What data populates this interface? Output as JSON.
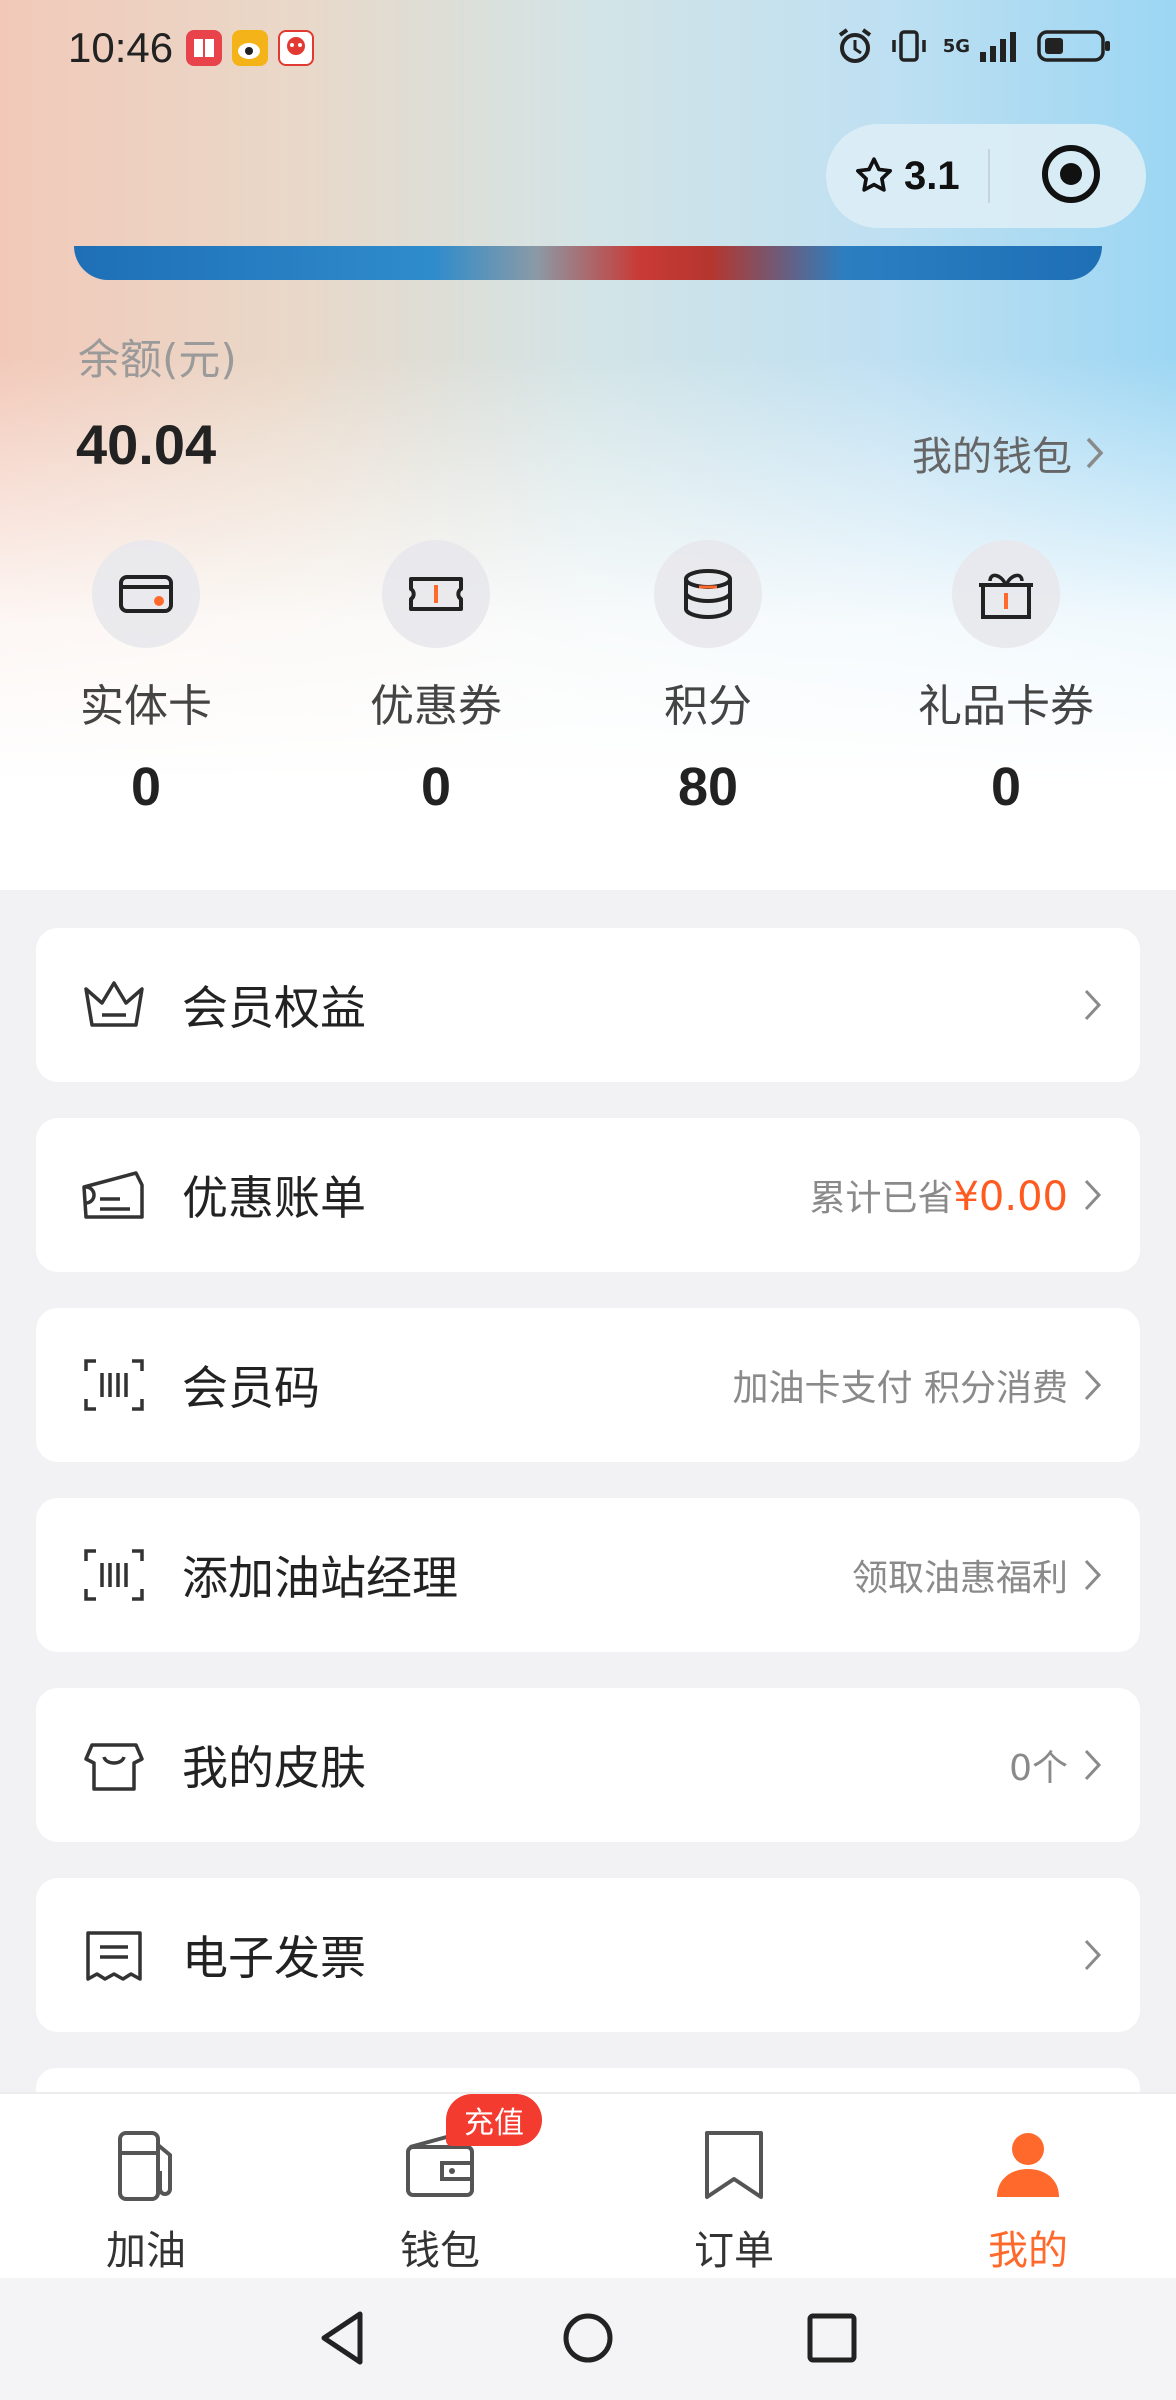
{
  "status_bar": {
    "time": "10:46",
    "network": "5G",
    "colors": {
      "notif1": "#e8424b",
      "notif2": "#f5b31a",
      "notif3": "#e23a32"
    }
  },
  "capsule": {
    "rating": "3.1",
    "star_icon": "star-outline-icon",
    "target_icon": "target-icon"
  },
  "balance": {
    "label": "余额(元)",
    "value": "40.04",
    "wallet_link": "我的钱包"
  },
  "stats": [
    {
      "label": "实体卡",
      "value": "0",
      "icon": "card-icon"
    },
    {
      "label": "优惠券",
      "value": "0",
      "icon": "ticket-icon"
    },
    {
      "label": "积分",
      "value": "80",
      "icon": "coin-stack-icon"
    },
    {
      "label": "礼品卡券",
      "value": "0",
      "icon": "gift-icon"
    }
  ],
  "menu": [
    {
      "title": "会员权益",
      "right": "",
      "icon": "crown-icon"
    },
    {
      "title": "优惠账单",
      "right_prefix": "累计已省",
      "right_highlight": "¥0.00",
      "icon": "coupon-bill-icon"
    },
    {
      "title": "会员码",
      "right": "加油卡支付 积分消费",
      "icon": "barcode-icon"
    },
    {
      "title": "添加油站经理",
      "right": "领取油惠福利",
      "icon": "barcode-icon"
    },
    {
      "title": "我的皮肤",
      "right": "0个",
      "icon": "shirt-icon"
    },
    {
      "title": "电子发票",
      "right": "",
      "icon": "receipt-icon"
    }
  ],
  "tabbar": {
    "badge": "充值",
    "tabs": [
      {
        "label": "加油",
        "icon": "fuel-pump-icon"
      },
      {
        "label": "钱包",
        "icon": "wallet-icon"
      },
      {
        "label": "订单",
        "icon": "bookmark-icon"
      },
      {
        "label": "我的",
        "icon": "person-icon",
        "active": true
      }
    ]
  },
  "accent": "#ff6a2c"
}
